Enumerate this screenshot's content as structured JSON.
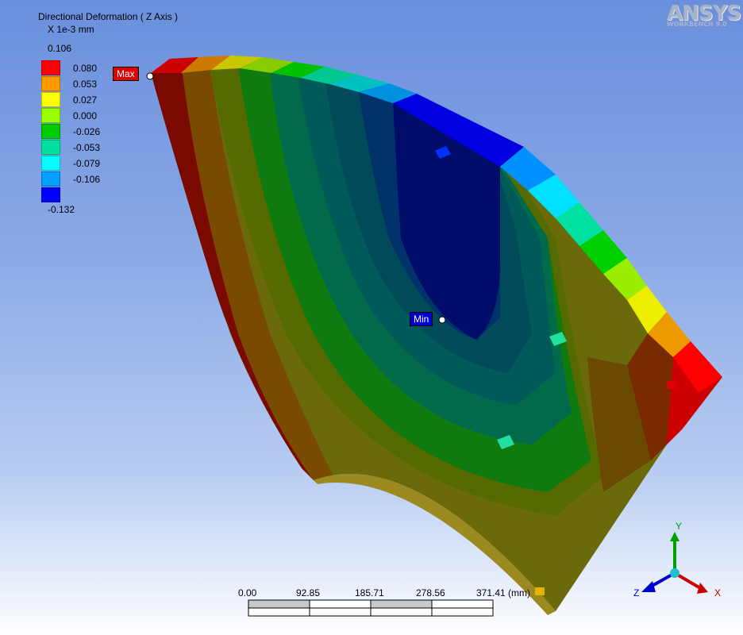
{
  "legend": {
    "title": "Directional Deformation ( Z Axis )",
    "units": "X 1e-3 mm",
    "max_value": "0.106",
    "min_value": "-0.132",
    "entries": [
      {
        "value": "0.080",
        "color": "#ff0000"
      },
      {
        "value": "0.053",
        "color": "#ff9900"
      },
      {
        "value": "0.027",
        "color": "#ffff00"
      },
      {
        "value": "0.000",
        "color": "#99ff00"
      },
      {
        "value": "-0.026",
        "color": "#00cc00"
      },
      {
        "value": "-0.053",
        "color": "#00e0a0"
      },
      {
        "value": "-0.079",
        "color": "#00ffff"
      },
      {
        "value": "-0.106",
        "color": "#00a0ff"
      },
      {
        "value": "",
        "color": "#0000ff"
      }
    ]
  },
  "logo": {
    "name": "ANSYS",
    "subtitle": "WORKBENCH 9.0"
  },
  "probes": {
    "max_label": "Max",
    "min_label": "Min"
  },
  "scale_bar": {
    "labels": [
      "0.00",
      "92.85",
      "185.71",
      "278.56",
      "371.41 (mm)"
    ]
  },
  "triad": {
    "x": "X",
    "y": "Y",
    "z": "Z"
  },
  "colors": {
    "band_red": "#e00000",
    "band_orange": "#cc7a00",
    "band_olive": "#6a6a00",
    "band_green": "#007a00",
    "band_teal": "#006a5a",
    "band_navy": "#00005a"
  }
}
